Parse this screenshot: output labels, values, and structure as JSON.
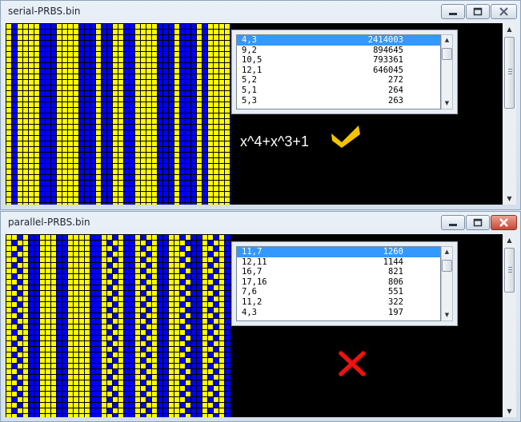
{
  "windows": [
    {
      "title": "serial-PRBS.bin",
      "rows": [
        {
          "key": "4,3",
          "value": "2414003",
          "selected": true
        },
        {
          "key": "9,2",
          "value": "894645"
        },
        {
          "key": "10,5",
          "value": "793361"
        },
        {
          "key": "12,1",
          "value": "646045"
        },
        {
          "key": "5,2",
          "value": "272"
        },
        {
          "key": "5,1",
          "value": "264"
        },
        {
          "key": "5,3",
          "value": "263"
        }
      ],
      "polynomial": "x^4+x^3+1",
      "verdict_icon": "checkmark-icon",
      "close_active": false
    },
    {
      "title": "parallel-PRBS.bin",
      "rows": [
        {
          "key": "11,7",
          "value": "1260",
          "selected": true
        },
        {
          "key": "12,11",
          "value": "1144"
        },
        {
          "key": "16,7",
          "value": "821"
        },
        {
          "key": "17,16",
          "value": "806"
        },
        {
          "key": "7,6",
          "value": "551"
        },
        {
          "key": "11,2",
          "value": "322"
        },
        {
          "key": "4,3",
          "value": "197"
        }
      ],
      "verdict_icon": "x-mark-icon",
      "close_active": true
    }
  ],
  "colors": {
    "bit_one": "#ffff00",
    "bit_zero": "#0000ff",
    "grid_line": "#000000",
    "check": "#f5c400",
    "cross": "#ee1111",
    "selection": "#3399ff"
  },
  "icons": [
    "minimize-icon",
    "maximize-icon",
    "close-icon",
    "scroll-up-icon",
    "scroll-down-icon"
  ]
}
